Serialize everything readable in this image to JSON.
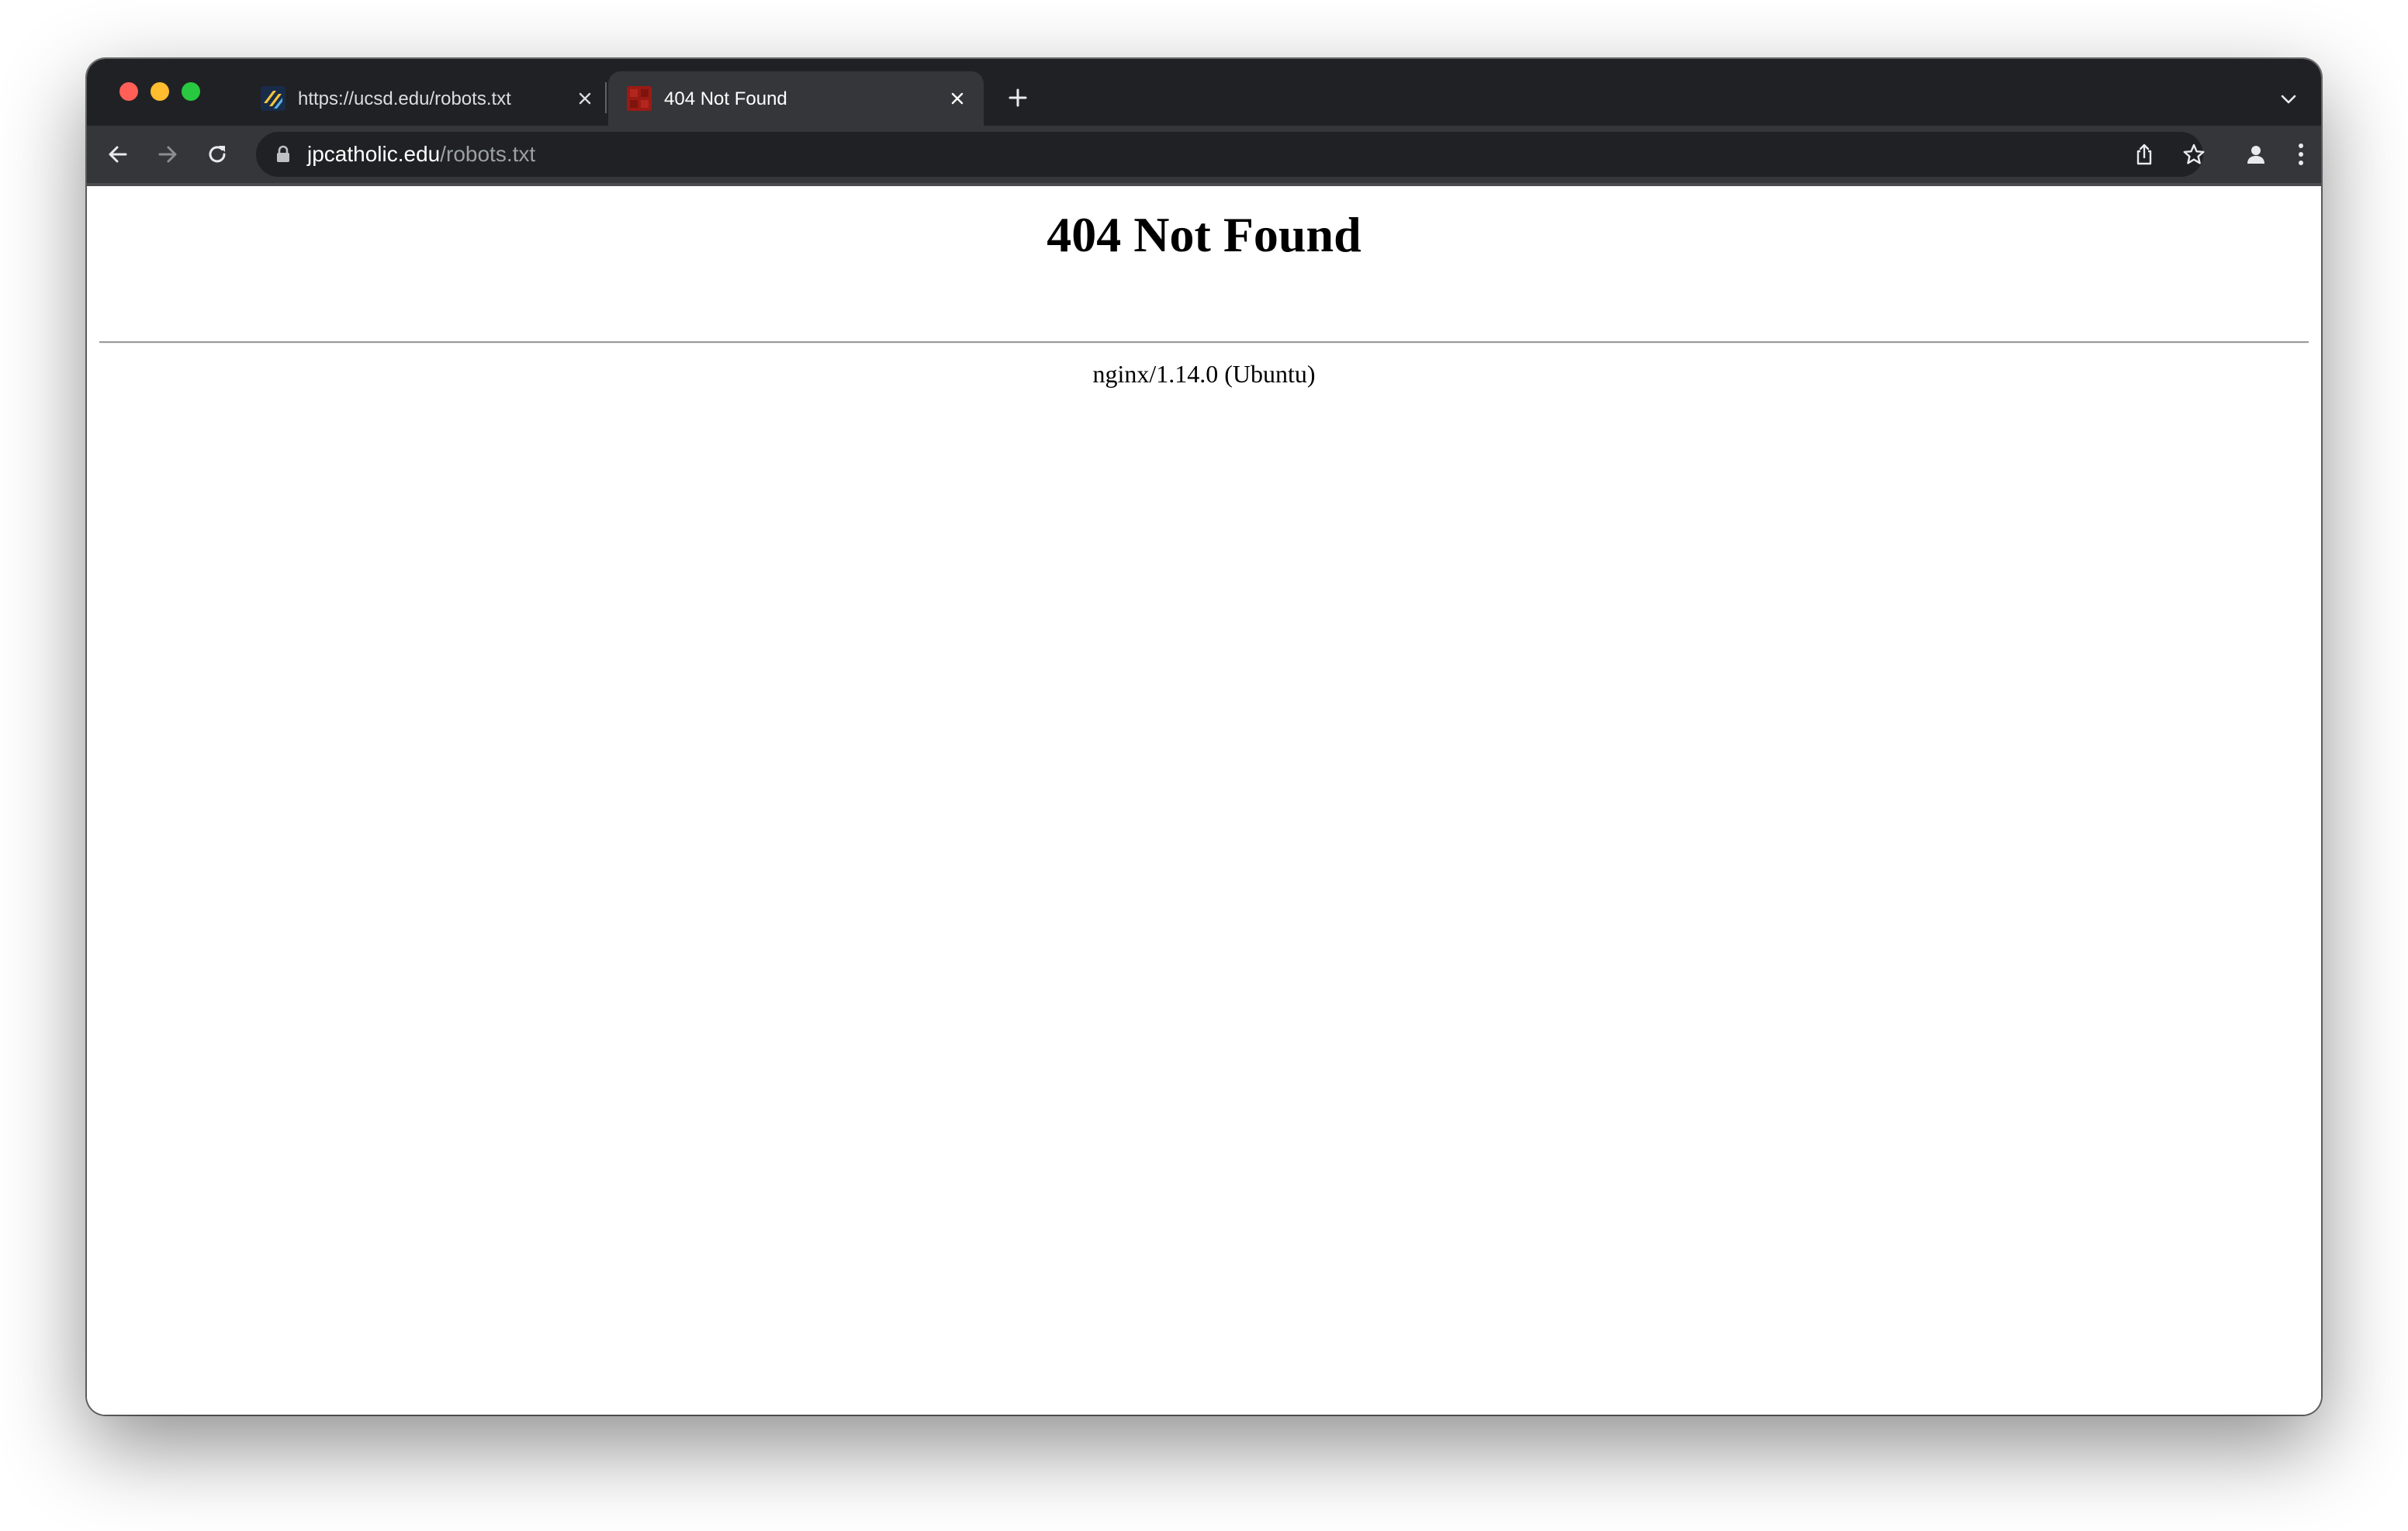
{
  "browser": {
    "tabs": [
      {
        "title": "https://ucsd.edu/robots.txt",
        "favicon": "ucsd-favicon-icon",
        "active": false
      },
      {
        "title": "404 Not Found",
        "favicon": "red-square-favicon-icon",
        "active": true
      }
    ],
    "address": {
      "host": "jpcatholic.edu",
      "path": "/robots.txt"
    },
    "icons": {
      "back": "arrow-left-icon",
      "forward": "arrow-right-icon",
      "reload": "reload-icon",
      "lock": "lock-icon",
      "share": "share-icon",
      "bookmark": "star-icon",
      "profile": "person-icon",
      "menu": "kebab-menu-icon",
      "new_tab": "plus-icon",
      "tab_search": "chevron-down-icon"
    },
    "colors": {
      "frame": "#202124",
      "toolbar": "#35363a",
      "active_tab": "#35363a",
      "close_red": "#ff5f57",
      "minimize_yellow": "#febc2e",
      "zoom_green": "#28c840"
    }
  },
  "page": {
    "heading": "404 Not Found",
    "footer": "nginx/1.14.0 (Ubuntu)"
  }
}
